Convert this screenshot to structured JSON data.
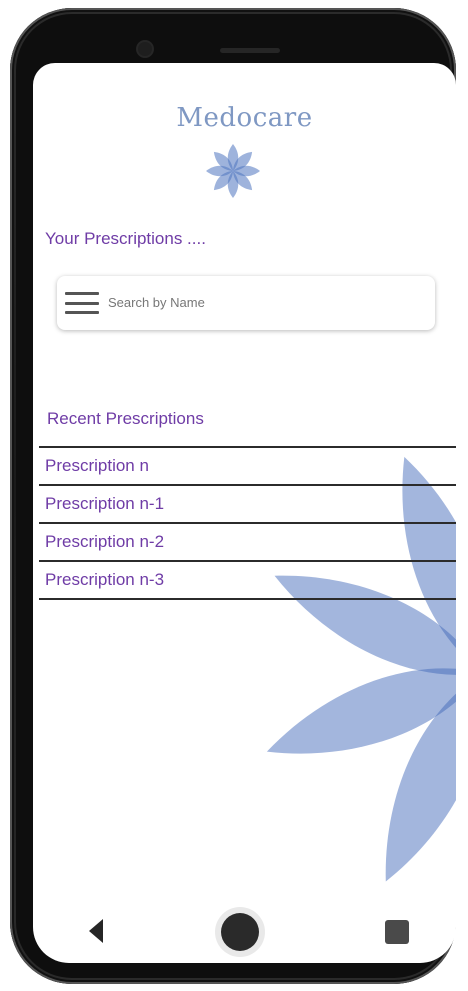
{
  "app": {
    "brand": "Medocare"
  },
  "main": {
    "section_title": "Your Prescriptions ....",
    "search": {
      "placeholder": "Search by Name"
    },
    "recent_title": "Recent Prescriptions",
    "prescriptions": [
      "Prescription n",
      "Prescription n-1",
      "Prescription n-2",
      "Prescription n-3"
    ]
  },
  "icons": {
    "menu": "hamburger-menu-icon",
    "logo": "flower-logo-icon",
    "back": "back-triangle-icon",
    "home": "home-circle-icon",
    "recents": "recents-square-icon"
  },
  "colors": {
    "brand_text": "#7f98c3",
    "accent_purple": "#6f3ca6",
    "flower_blue": "#3f67b8",
    "divider": "#2b2b2b"
  }
}
